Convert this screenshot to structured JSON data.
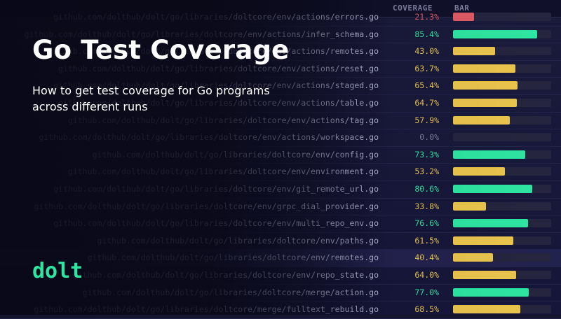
{
  "header": {
    "coverage_label": "COVERAGE",
    "bar_label": "BAR"
  },
  "hero": {
    "title": "Go Test Coverage",
    "subtitle": "How to get test coverage for Go programs across different runs",
    "logo_text": "dolt"
  },
  "colors": {
    "green": "#2ee6a2",
    "yellow": "#ebc64d",
    "red": "#e05a65",
    "zero": "#7d7f9c"
  },
  "rows": [
    {
      "path": "github.com/dolthub/dolt/go/libraries/doltcore/env/actions/errors.go",
      "pct": "21.3%",
      "value": 21.3,
      "level": "red"
    },
    {
      "path": "github.com/dolthub/dolt/go/libraries/doltcore/env/actions/infer_schema.go",
      "pct": "85.4%",
      "value": 85.4,
      "level": "green"
    },
    {
      "path": "github.com/dolthub/dolt/go/libraries/doltcore/env/actions/remotes.go",
      "pct": "43.0%",
      "value": 43.0,
      "level": "yellow"
    },
    {
      "path": "github.com/dolthub/dolt/go/libraries/doltcore/env/actions/reset.go",
      "pct": "63.7%",
      "value": 63.7,
      "level": "yellow"
    },
    {
      "path": "github.com/dolthub/dolt/go/libraries/doltcore/env/actions/staged.go",
      "pct": "65.4%",
      "value": 65.4,
      "level": "yellow"
    },
    {
      "path": "github.com/dolthub/dolt/go/libraries/doltcore/env/actions/table.go",
      "pct": "64.7%",
      "value": 64.7,
      "level": "yellow"
    },
    {
      "path": "github.com/dolthub/dolt/go/libraries/doltcore/env/actions/tag.go",
      "pct": "57.9%",
      "value": 57.9,
      "level": "yellow"
    },
    {
      "path": "github.com/dolthub/dolt/go/libraries/doltcore/env/actions/workspace.go",
      "pct": "0.0%",
      "value": 0.0,
      "level": "zero"
    },
    {
      "path": "github.com/dolthub/dolt/go/libraries/doltcore/env/config.go",
      "pct": "73.3%",
      "value": 73.3,
      "level": "green"
    },
    {
      "path": "github.com/dolthub/dolt/go/libraries/doltcore/env/environment.go",
      "pct": "53.2%",
      "value": 53.2,
      "level": "yellow"
    },
    {
      "path": "github.com/dolthub/dolt/go/libraries/doltcore/env/git_remote_url.go",
      "pct": "80.6%",
      "value": 80.6,
      "level": "green"
    },
    {
      "path": "github.com/dolthub/dolt/go/libraries/doltcore/env/grpc_dial_provider.go",
      "pct": "33.8%",
      "value": 33.8,
      "level": "yellow"
    },
    {
      "path": "github.com/dolthub/dolt/go/libraries/doltcore/env/multi_repo_env.go",
      "pct": "76.6%",
      "value": 76.6,
      "level": "green"
    },
    {
      "path": "github.com/dolthub/dolt/go/libraries/doltcore/env/paths.go",
      "pct": "61.5%",
      "value": 61.5,
      "level": "yellow"
    },
    {
      "path": "github.com/dolthub/dolt/go/libraries/doltcore/env/remotes.go",
      "pct": "40.4%",
      "value": 40.4,
      "level": "yellow",
      "highlight": true
    },
    {
      "path": "github.com/dolthub/dolt/go/libraries/doltcore/env/repo_state.go",
      "pct": "64.0%",
      "value": 64.0,
      "level": "yellow"
    },
    {
      "path": "github.com/dolthub/dolt/go/libraries/doltcore/merge/action.go",
      "pct": "77.0%",
      "value": 77.0,
      "level": "green"
    },
    {
      "path": "github.com/dolthub/dolt/go/libraries/doltcore/merge/fulltext_rebuild.go",
      "pct": "68.5%",
      "value": 68.5,
      "level": "yellow"
    }
  ]
}
